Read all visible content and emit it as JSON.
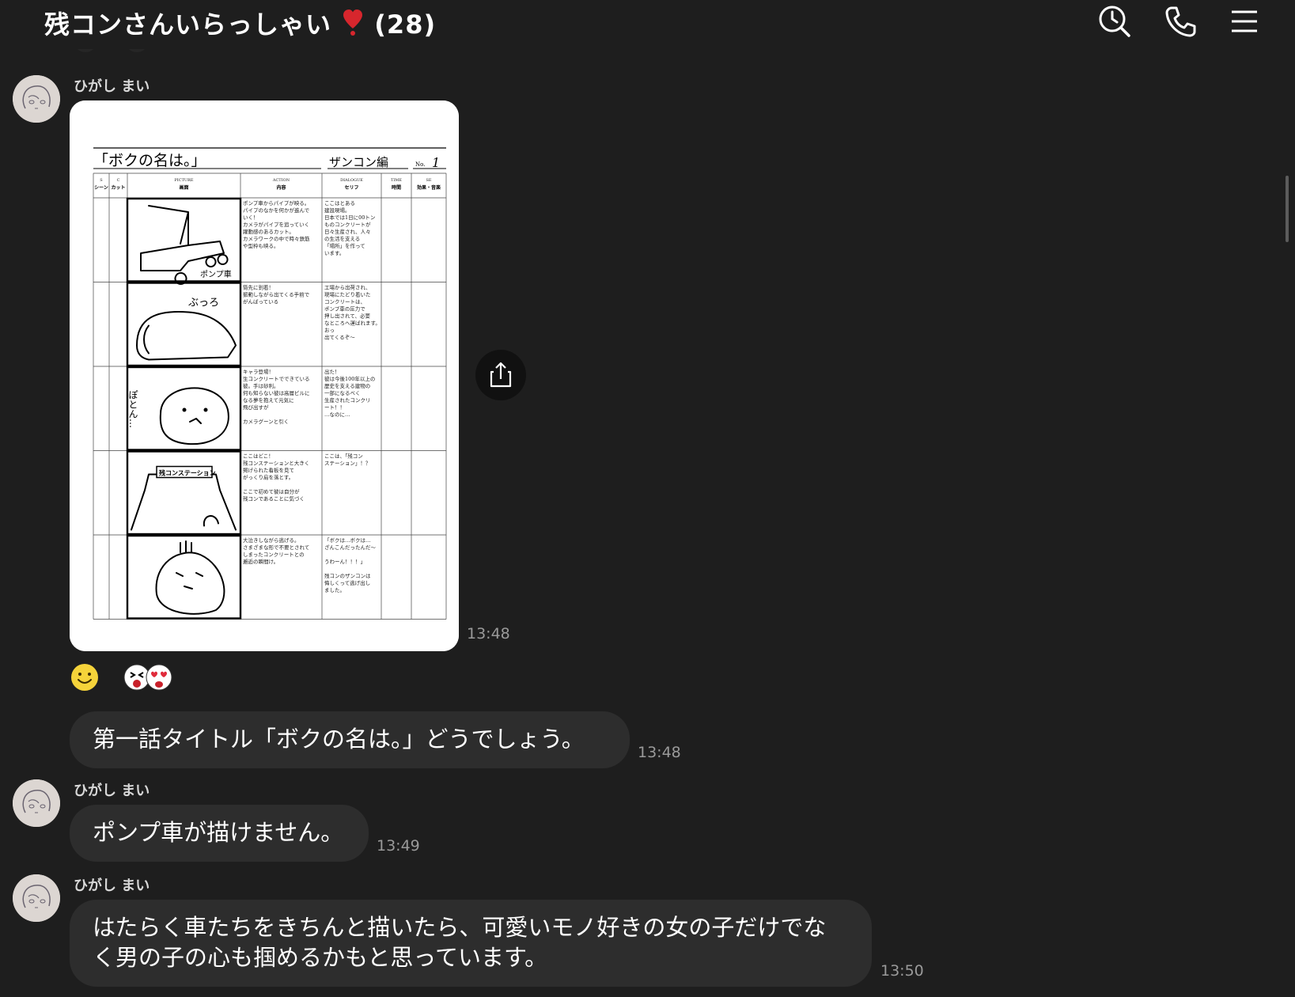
{
  "header": {
    "title": "残コンさんいらっしゃい",
    "member_count": "(28)"
  },
  "icons": [
    "search-clock-icon",
    "phone-icon",
    "menu-icon",
    "share-icon"
  ],
  "messages": [
    {
      "sender": "ひがし まい",
      "type": "image",
      "time": "13:48",
      "image": {
        "title": "「ボクの名は。」",
        "episode": "ザンコン編",
        "no_label": "No.",
        "no_value": "1",
        "columns": [
          {
            "en": "S",
            "jp": "シーン"
          },
          {
            "en": "C",
            "jp": "カット"
          },
          {
            "en": "PICTURE",
            "jp": "画面"
          },
          {
            "en": "ACTION",
            "jp": "内容"
          },
          {
            "en": "DIALOGUE",
            "jp": "セリフ"
          },
          {
            "en": "TIME",
            "jp": "時間"
          },
          {
            "en": "SE",
            "jp": "効果・音楽"
          }
        ],
        "panel_labels": [
          "ポンプ車",
          "ぶっろ",
          "ぽとん…",
          "残コンステーション"
        ],
        "rows": [
          {
            "action": [
              "ポンプ車からパイプが映る。",
              "パイプのなかを何かが進んで",
              "いく！",
              "カメラがパイプを追っていく",
              "躍動感のあるカット。",
              "カメラワークの中で時々鉄筋",
              "や型枠も映る。"
            ],
            "dialogue": [
              "ここはとある",
              "建設現場。",
              "日本では1日に00トン",
              "ものコンクリートが",
              "日々生産され、人々",
              "の生活を支える",
              "「場所」を作って",
              "います。"
            ]
          },
          {
            "action": [
              "筒先に到着！",
              "振動しながら出てくる手前で",
              "がんばっている"
            ],
            "dialogue": [
              "工場から出荷され、",
              "現場にたどり着いた",
              "コンクリートは、",
              "ポンプ車の圧力で",
              "押し出されて、必要",
              "なところへ運ばれます。",
              "おっ",
              "出てくるぞ〜"
            ]
          },
          {
            "action": [
              "キャラ登場！",
              "生コンクリートでできている",
              "彼。手は砂利。",
              "何も知らない彼は高層ビルに",
              "なる夢を抱えて元気に",
              "飛び出すが",
              "",
              "カメラグーンと引く"
            ],
            "dialogue": [
              "出た！",
              "彼は今後100年以上の",
              "歴史を支える建物の",
              "一部になるべく",
              "生産されたコンクリ",
              "ート！！",
              "…なのに…"
            ]
          },
          {
            "action": [
              "ここはどこ！",
              "残コンステーションと大きく",
              "掲げられた看板を見て",
              "がっくり肩を落とす。",
              "",
              "ここで初めて彼は自分が",
              "残コンであることに気づく"
            ],
            "dialogue": [
              "ここは、「残コン",
              "ステーション」！？"
            ]
          },
          {
            "action": [
              "大泣きしながら逃げる。",
              "さまざまな形で不要とされて",
              "しまったコンクリートとの",
              "邂逅の瞬間け。"
            ],
            "dialogue": [
              "「ボクは…ボクは…",
              "ざんこんだったんだ〜",
              "",
              "うわーん！！！」",
              "",
              "残コンのザンコンは",
              "悔しくって逃げ出し",
              "ました。"
            ]
          }
        ]
      }
    },
    {
      "type": "text",
      "text": "第一話タイトル「ボクの名は。」どうでしょう。",
      "time": "13:48"
    },
    {
      "sender": "ひがし まい",
      "type": "text",
      "text": "ポンプ車が描けません。",
      "time": "13:49"
    },
    {
      "sender": "ひがし まい",
      "type": "text",
      "lines": [
        "はたらく車たちをきちんと描いたら、可愛いモノ好きの女の子だけでな",
        "く男の子の心も掴めるかもと思っています。"
      ],
      "time": "13:50"
    }
  ],
  "colors": {
    "background": "#1e1e1e",
    "bubble": "#2d2d2d",
    "time_text": "#9a9a9a",
    "heart": "#d7262d",
    "reaction_yellow": "#f5d33a"
  }
}
